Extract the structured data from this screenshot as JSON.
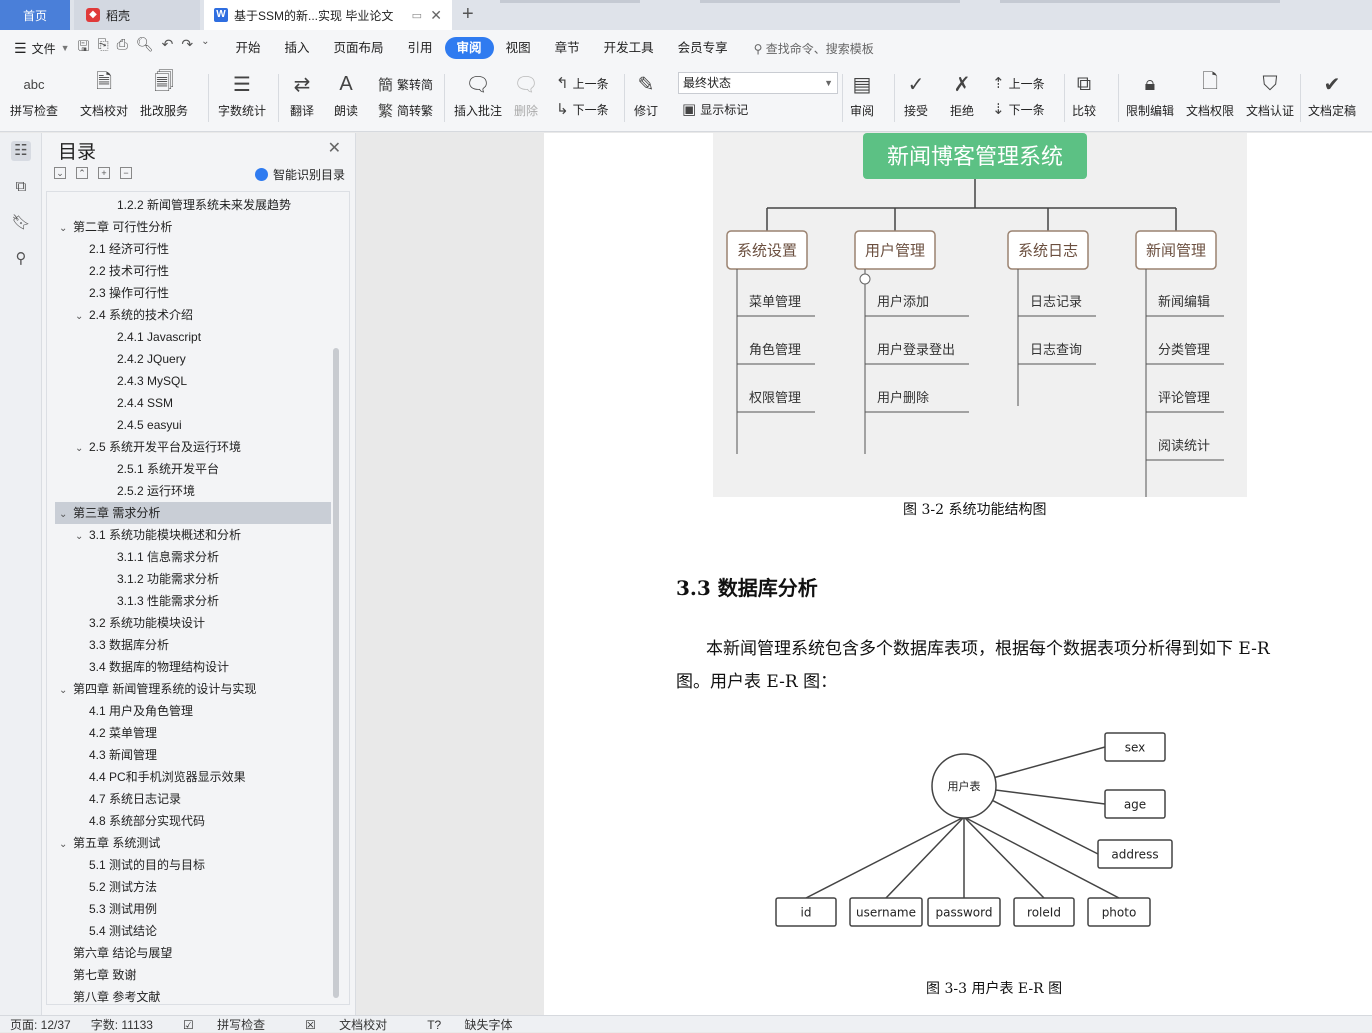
{
  "tabs": {
    "home": "首页",
    "daoke": "稻壳",
    "doc": "基于SSM的新...实现 毕业论文"
  },
  "menu": {
    "file": "文件",
    "items": [
      "开始",
      "插入",
      "页面布局",
      "引用",
      "审阅",
      "视图",
      "章节",
      "开发工具",
      "会员专享"
    ],
    "active": "审阅",
    "search": "查找命令、搜索模板"
  },
  "ribbon": {
    "spell": "拼写检查",
    "proof": "文档校对",
    "batch": "批改服务",
    "wordcount": "字数统计",
    "translate": "翻译",
    "read": "朗读",
    "trad": "繁转简",
    "simp": "简转繁",
    "insert_comment": "插入批注",
    "delete": "删除",
    "prev": "上一条",
    "next": "下一条",
    "revise": "修订",
    "final_state": "最终状态",
    "show_marks": "显示标记",
    "review": "审阅",
    "accept": "接受",
    "reject": "拒绝",
    "prev2": "上一条",
    "next2": "下一条",
    "compare": "比较",
    "restrict": "限制编辑",
    "rights": "文档权限",
    "certify": "文档认证",
    "finalize": "文档定稿"
  },
  "toc": {
    "title": "目录",
    "smart": "智能识别目录",
    "rows": [
      {
        "text": "1.2.2  新闻管理系统未来发展趋势",
        "level": 3,
        "chev": ""
      },
      {
        "text": "第二章  可行性分析",
        "level": 1,
        "chev": "v"
      },
      {
        "text": "2.1  经济可行性",
        "level": 2,
        "chev": ""
      },
      {
        "text": "2.2  技术可行性",
        "level": 2,
        "chev": ""
      },
      {
        "text": "2.3  操作可行性",
        "level": 2,
        "chev": ""
      },
      {
        "text": "2.4  系统的技术介绍",
        "level": 2,
        "chev": "v"
      },
      {
        "text": "2.4.1 Javascript",
        "level": 3,
        "chev": ""
      },
      {
        "text": "2.4.2 JQuery",
        "level": 3,
        "chev": ""
      },
      {
        "text": "2.4.3 MySQL",
        "level": 3,
        "chev": ""
      },
      {
        "text": "2.4.4 SSM",
        "level": 3,
        "chev": ""
      },
      {
        "text": "2.4.5 easyui",
        "level": 3,
        "chev": ""
      },
      {
        "text": "2.5  系统开发平台及运行环境",
        "level": 2,
        "chev": "v"
      },
      {
        "text": "2.5.1  系统开发平台",
        "level": 3,
        "chev": ""
      },
      {
        "text": "2.5.2  运行环境",
        "level": 3,
        "chev": ""
      },
      {
        "text": "第三章  需求分析",
        "level": 1,
        "chev": "v",
        "selected": true
      },
      {
        "text": "3.1  系统功能模块概述和分析",
        "level": 2,
        "chev": "v"
      },
      {
        "text": "3.1.1  信息需求分析",
        "level": 3,
        "chev": ""
      },
      {
        "text": "3.1.2  功能需求分析",
        "level": 3,
        "chev": ""
      },
      {
        "text": "3.1.3  性能需求分析",
        "level": 3,
        "chev": ""
      },
      {
        "text": "3.2  系统功能模块设计",
        "level": 2,
        "chev": ""
      },
      {
        "text": "3.3  数据库分析",
        "level": 2,
        "chev": ""
      },
      {
        "text": "3.4  数据库的物理结构设计",
        "level": 2,
        "chev": ""
      },
      {
        "text": "第四章  新闻管理系统的设计与实现",
        "level": 1,
        "chev": "v"
      },
      {
        "text": "4.1    用户及角色管理",
        "level": 2,
        "chev": ""
      },
      {
        "text": "4.2    菜单管理",
        "level": 2,
        "chev": ""
      },
      {
        "text": "4.3    新闻管理",
        "level": 2,
        "chev": ""
      },
      {
        "text": "4.4    PC和手机浏览器显示效果",
        "level": 2,
        "chev": ""
      },
      {
        "text": "4.7    系统日志记录",
        "level": 2,
        "chev": ""
      },
      {
        "text": "4.8    系统部分实现代码",
        "level": 2,
        "chev": ""
      },
      {
        "text": "第五章  系统测试",
        "level": 1,
        "chev": "v"
      },
      {
        "text": "5.1  测试的目的与目标",
        "level": 2,
        "chev": ""
      },
      {
        "text": "5.2  测试方法",
        "level": 2,
        "chev": ""
      },
      {
        "text": "5.3  测试用例",
        "level": 2,
        "chev": ""
      },
      {
        "text": "5.4  测试结论",
        "level": 2,
        "chev": ""
      },
      {
        "text": "第六章  结论与展望",
        "level": 1,
        "chev": ""
      },
      {
        "text": "第七章  致谢",
        "level": 1,
        "chev": ""
      },
      {
        "text": "第八章  参考文献",
        "level": 1,
        "chev": ""
      }
    ]
  },
  "doc": {
    "fig1": {
      "root": "新闻博客管理系统",
      "groups": [
        {
          "name": "系统设置",
          "items": [
            "菜单管理",
            "角色管理",
            "权限管理"
          ]
        },
        {
          "name": "用户管理",
          "items": [
            "用户添加",
            "用户登录登出",
            "用户删除"
          ]
        },
        {
          "name": "系统日志",
          "items": [
            "日志记录",
            "日志查询"
          ]
        },
        {
          "name": "新闻管理",
          "items": [
            "新闻编辑",
            "分类管理",
            "评论管理",
            "阅读统计"
          ]
        }
      ],
      "caption": "图 3-2  系统功能结构图"
    },
    "heading": "3.3  数据库分析",
    "para1": "本新闻管理系统包含多个数据库表项，根据每个数据表项分析得到如下 E-R",
    "para2": "图。用户表 E-R 图：",
    "fig2": {
      "entity": "用户表",
      "attrs": [
        "sex",
        "age",
        "address",
        "id",
        "username",
        "password",
        "roleId",
        "photo"
      ],
      "caption": "图 3-3  用户表 E-R 图"
    }
  },
  "status": {
    "page": "页面: 12/37",
    "words": "字数: 11133",
    "spell": "拼写检查",
    "proof": "文档校对",
    "font": "缺失字体"
  }
}
